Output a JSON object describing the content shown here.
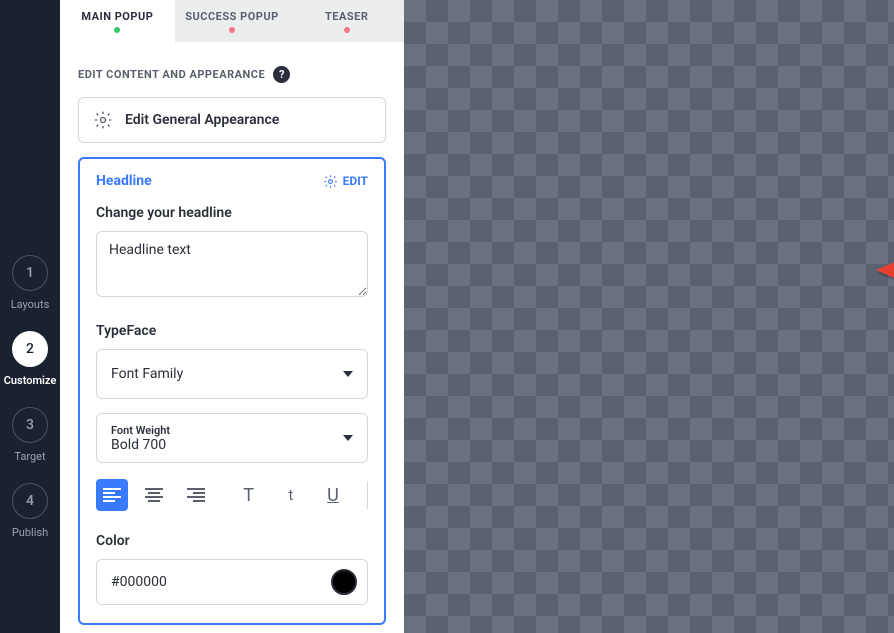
{
  "rail": {
    "steps": [
      {
        "num": "1",
        "label": "Layouts"
      },
      {
        "num": "2",
        "label": "Customize"
      },
      {
        "num": "3",
        "label": "Target"
      },
      {
        "num": "4",
        "label": "Publish"
      }
    ]
  },
  "tabs": {
    "main": "MAIN POPUP",
    "success": "SUCCESS POPUP",
    "teaser": "TEASER",
    "dot_active": "#35c66b",
    "dot_inactive": "#ef7a85"
  },
  "section_title": "EDIT CONTENT AND APPEARANCE",
  "general_button": "Edit General Appearance",
  "card": {
    "title": "Headline",
    "edit_label": "EDIT",
    "headline_label": "Change your headline",
    "headline_value": "Headline text",
    "typeface_label": "TypeFace",
    "font_family_placeholder": "Font Family",
    "font_weight_label": "Font Weight",
    "font_weight_value": "Bold 700",
    "color_label": "Color",
    "color_value": "#000000",
    "color_swatch": "#000000"
  }
}
